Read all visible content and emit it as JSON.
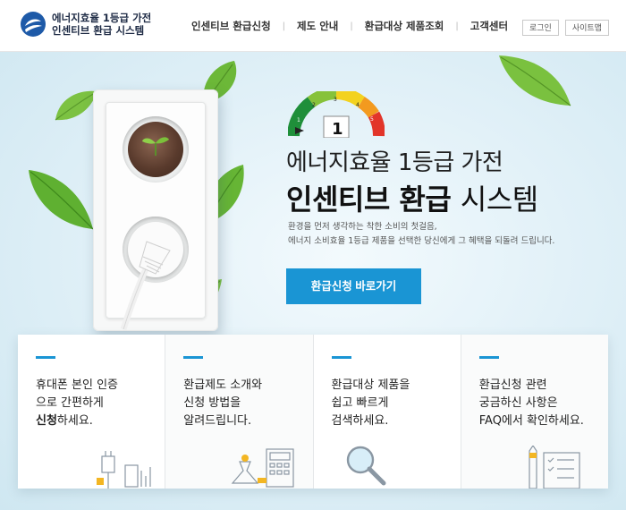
{
  "header": {
    "logo_line1": "에너지효율 1등급 가전",
    "logo_line2": "인센티브 환급 시스템",
    "nav": [
      "인센티브 환급신청",
      "제도 안내",
      "환급대상 제품조회",
      "고객센터"
    ],
    "nav_sep": "|",
    "login": "로그인",
    "sitemap": "사이트맵"
  },
  "hero": {
    "title1": "에너지효율 1등급 가전",
    "title2_bold": "인센티브 환급",
    "title2_light": "시스템",
    "desc_line1": "환경을 먼저 생각하는 착한 소비의 첫걸음,",
    "desc_line2": "에너지 소비효율 1등급 제품을 선택한 당신에게 그 혜택을 되돌려 드립니다.",
    "cta": "환급신청 바로가기",
    "gauge": {
      "grade_label": "1",
      "ticks": [
        "1",
        "2",
        "3",
        "4",
        "5"
      ]
    }
  },
  "cards": [
    {
      "line1": "휴대폰 본인 인증",
      "line2": "으로 간편하게",
      "line3_bold": "신청",
      "line3_rest": "하세요.",
      "icon": "phone-charger-icon"
    },
    {
      "line1": "환급제도 소개와",
      "line2": "신청 방법을",
      "line3_bold": "",
      "line3_rest": "알려드립니다.",
      "icon": "calculator-money-icon"
    },
    {
      "line1": "환급대상 제품을",
      "line2": "쉽고 빠르게",
      "line3_bold": "",
      "line3_rest": "검색하세요.",
      "icon": "magnifier-icon"
    },
    {
      "line1": "환급신청 관련",
      "line2": "궁금하신 사항은",
      "line3_bold": "",
      "line3_rest": "FAQ에서 확인하세요.",
      "icon": "checklist-pencil-icon"
    }
  ],
  "colors": {
    "accent": "#1a95d4",
    "title": "#111111",
    "leaf": "#6dbb3a"
  }
}
